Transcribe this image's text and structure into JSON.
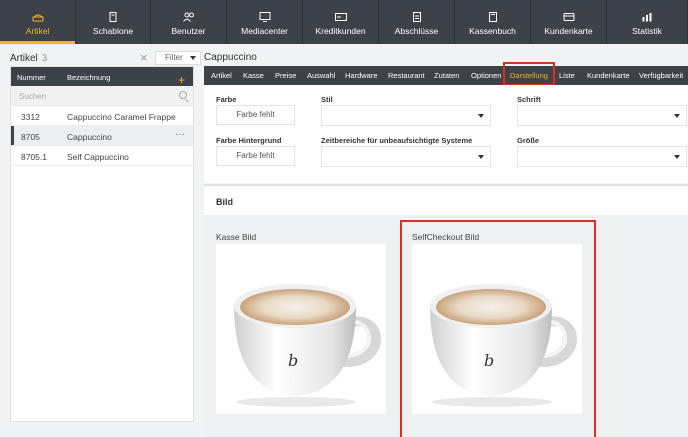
{
  "nav": [
    {
      "label": "Artikel",
      "icon": "cake-icon",
      "active": true
    },
    {
      "label": "Schablone",
      "icon": "template-icon",
      "active": false
    },
    {
      "label": "Benutzer",
      "icon": "users-icon",
      "active": false
    },
    {
      "label": "Mediacenter",
      "icon": "monitor-icon",
      "active": false
    },
    {
      "label": "Kreditkunden",
      "icon": "card-icon",
      "active": false
    },
    {
      "label": "Abschlüsse",
      "icon": "clipboard-icon",
      "active": false
    },
    {
      "label": "Kassenbuch",
      "icon": "book-icon",
      "active": false
    },
    {
      "label": "Kundenkarte",
      "icon": "wallet-icon",
      "active": false
    },
    {
      "label": "Statistik",
      "icon": "chart-icon",
      "active": false
    }
  ],
  "left": {
    "title": "Artikel",
    "count": "3",
    "filter_label": "Filter",
    "col_number": "Nummer",
    "col_desc": "Bezeichnung",
    "search_placeholder": "Suchen",
    "rows": [
      {
        "num": "3312",
        "desc": "Cappuccino Caramel Frappe",
        "selected": false
      },
      {
        "num": "8705",
        "desc": "Cappuccino",
        "selected": true
      },
      {
        "num": "8705.1",
        "desc": "Self Cappuccino",
        "selected": false
      }
    ],
    "more": "···"
  },
  "right": {
    "title": "Cappuccino",
    "tabs": [
      "Artikel",
      "Kasse",
      "Preise",
      "Auswahl",
      "Hardware",
      "Restaurant",
      "Zutaten",
      "Optionen",
      "Darstellung",
      "Liste",
      "Kundenkarte",
      "Verfügbarkeit"
    ],
    "active_tab": "Darstellung",
    "form": {
      "farbe_label": "Farbe",
      "farbe_value": "Farbe fehlt",
      "stil_label": "Stil",
      "schrift_label": "Schrift",
      "farbe_bg_label": "Farbe Hintergrund",
      "farbe_bg_value": "Farbe fehlt",
      "zeit_label": "Zeitbereiche für unbeaufsichtigte Systeme",
      "groesse_label": "Größe"
    },
    "bild": {
      "title": "Bild",
      "kasse_label": "Kasse Bild",
      "sc_label": "SelfCheckout Bild",
      "cup_logo": "b"
    }
  },
  "colors": {
    "accent": "#f0b429",
    "nav_bg": "#3d4248",
    "highlight": "#e02d22"
  }
}
